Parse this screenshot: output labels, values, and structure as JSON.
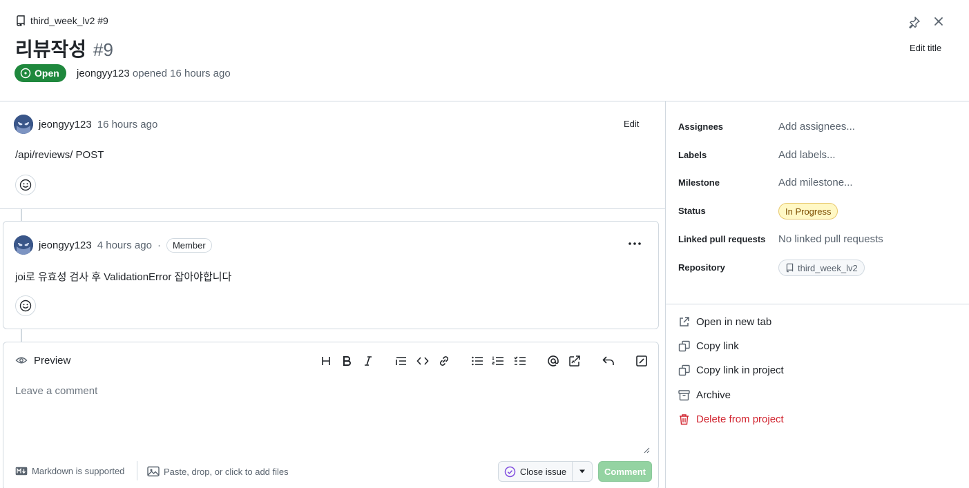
{
  "header": {
    "repo": "third_week_lv2 #9",
    "title": "리뷰작성",
    "number": "#9",
    "state": "Open",
    "author": "jeongyy123",
    "opened_text": " opened 16 hours ago",
    "edit_title": "Edit title"
  },
  "issue_body": {
    "author": "jeongyy123",
    "time": "16 hours ago",
    "edit": "Edit",
    "text": "/api/reviews/ POST"
  },
  "comment": {
    "author": "jeongyy123",
    "time": "4 hours ago",
    "separator": "·",
    "badge": "Member",
    "text": "joi로 유효성 검사 후 ValidationError 잡아야합니다"
  },
  "editor": {
    "preview_label": "Preview",
    "placeholder": "Leave a comment",
    "markdown_note": "Markdown is supported",
    "attach_note": "Paste, drop, or click to add files",
    "close_issue": "Close issue",
    "comment_button": "Comment"
  },
  "sidebar": {
    "fields": [
      {
        "label": "Assignees",
        "value": "Add assignees..."
      },
      {
        "label": "Labels",
        "value": "Add labels..."
      },
      {
        "label": "Milestone",
        "value": "Add milestone..."
      },
      {
        "label": "Status",
        "value": "In Progress"
      },
      {
        "label": "Linked pull requests",
        "value": "No linked pull requests"
      },
      {
        "label": "Repository",
        "value": "third_week_lv2"
      }
    ],
    "actions": [
      {
        "label": "Open in new tab",
        "icon": "link-external-icon"
      },
      {
        "label": "Copy link",
        "icon": "copy-icon"
      },
      {
        "label": "Copy link in project",
        "icon": "copy-icon"
      },
      {
        "label": "Archive",
        "icon": "archive-icon"
      },
      {
        "label": "Delete from project",
        "icon": "trash-icon"
      }
    ]
  },
  "colors": {
    "open_green": "#1f883d",
    "status_yellow": "#fff8c5",
    "danger_red": "#d1242f",
    "comment_disabled": "#94d3a2"
  }
}
